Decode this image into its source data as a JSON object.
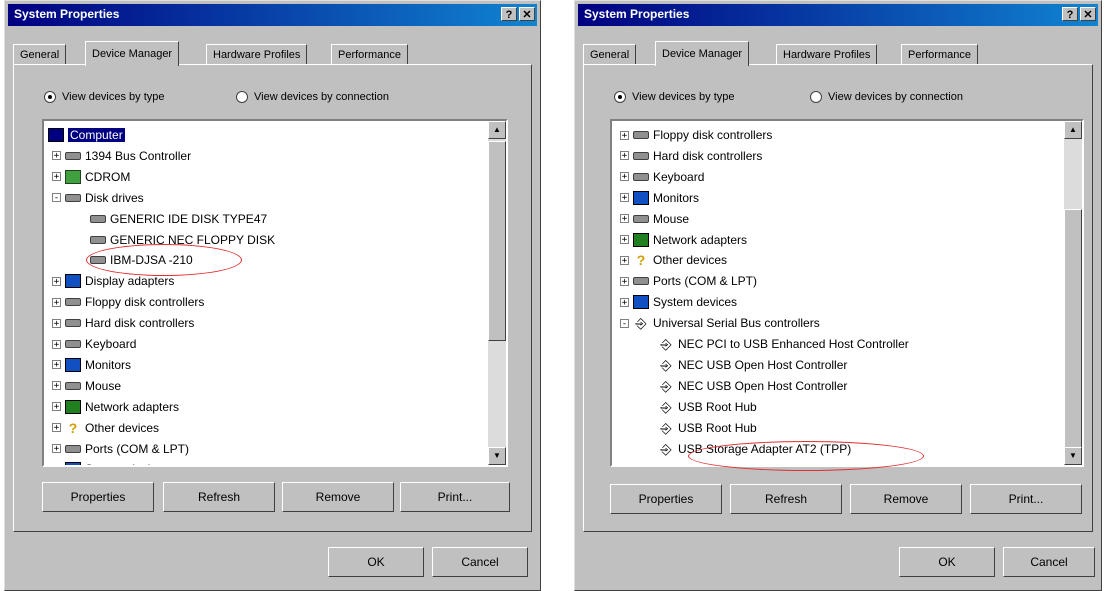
{
  "left": {
    "title": "System Properties",
    "help_btn": "?",
    "close_btn": "✕",
    "tabs": [
      "General",
      "Device Manager",
      "Hardware Profiles",
      "Performance"
    ],
    "radio_by_type": "View devices by type",
    "radio_by_connection": "View devices by connection",
    "tree": [
      {
        "label": "Computer",
        "exp": "",
        "icon": "comp"
      },
      {
        "label": "1394 Bus Controller",
        "exp": "+",
        "icon": "disk"
      },
      {
        "label": "CDROM",
        "exp": "+",
        "icon": "cd"
      },
      {
        "label": "Disk drives",
        "exp": "-",
        "icon": "disk"
      },
      {
        "label": "GENERIC IDE  DISK TYPE47",
        "exp": "",
        "icon": "disk"
      },
      {
        "label": "GENERIC NEC  FLOPPY DISK",
        "exp": "",
        "icon": "disk"
      },
      {
        "label": "IBM-DJSA -210",
        "exp": "",
        "icon": "disk"
      },
      {
        "label": "Display adapters",
        "exp": "+",
        "icon": "disp"
      },
      {
        "label": "Floppy disk controllers",
        "exp": "+",
        "icon": "disk"
      },
      {
        "label": "Hard disk controllers",
        "exp": "+",
        "icon": "disk"
      },
      {
        "label": "Keyboard",
        "exp": "+",
        "icon": "disk"
      },
      {
        "label": "Monitors",
        "exp": "+",
        "icon": "disp"
      },
      {
        "label": "Mouse",
        "exp": "+",
        "icon": "disk"
      },
      {
        "label": "Network adapters",
        "exp": "+",
        "icon": "net"
      },
      {
        "label": "Other devices",
        "exp": "+",
        "icon": "q"
      },
      {
        "label": "Ports (COM & LPT)",
        "exp": "+",
        "icon": "disk"
      },
      {
        "label": "System devices",
        "exp": "+",
        "icon": "disp"
      }
    ],
    "buttons": [
      "Properties",
      "Refresh",
      "Remove",
      "Print..."
    ],
    "ok": "OK",
    "cancel": "Cancel"
  },
  "right": {
    "title": "System Properties",
    "help_btn": "?",
    "close_btn": "✕",
    "tabs": [
      "General",
      "Device Manager",
      "Hardware Profiles",
      "Performance"
    ],
    "radio_by_type": "View devices by type",
    "radio_by_connection": "View devices by connection",
    "tree": [
      {
        "label": "Floppy disk controllers",
        "exp": "+",
        "icon": "disk"
      },
      {
        "label": "Hard disk controllers",
        "exp": "+",
        "icon": "disk"
      },
      {
        "label": "Keyboard",
        "exp": "+",
        "icon": "disk"
      },
      {
        "label": "Monitors",
        "exp": "+",
        "icon": "disp"
      },
      {
        "label": "Mouse",
        "exp": "+",
        "icon": "disk"
      },
      {
        "label": "Network adapters",
        "exp": "+",
        "icon": "net"
      },
      {
        "label": "Other devices",
        "exp": "+",
        "icon": "q"
      },
      {
        "label": "Ports (COM & LPT)",
        "exp": "+",
        "icon": "disk"
      },
      {
        "label": "System devices",
        "exp": "+",
        "icon": "disp"
      },
      {
        "label": "Universal Serial Bus controllers",
        "exp": "-",
        "icon": "usb"
      },
      {
        "label": "NEC PCI to USB Enhanced Host Controller",
        "exp": "",
        "icon": "usb"
      },
      {
        "label": "NEC USB Open Host Controller",
        "exp": "",
        "icon": "usb"
      },
      {
        "label": "NEC USB Open Host Controller",
        "exp": "",
        "icon": "usb"
      },
      {
        "label": "USB Root Hub",
        "exp": "",
        "icon": "usb"
      },
      {
        "label": "USB Root Hub",
        "exp": "",
        "icon": "usb"
      },
      {
        "label": "USB Storage Adapter AT2 (TPP)",
        "exp": "",
        "icon": "usb"
      }
    ],
    "buttons": [
      "Properties",
      "Refresh",
      "Remove",
      "Print..."
    ],
    "ok": "OK",
    "cancel": "Cancel"
  }
}
